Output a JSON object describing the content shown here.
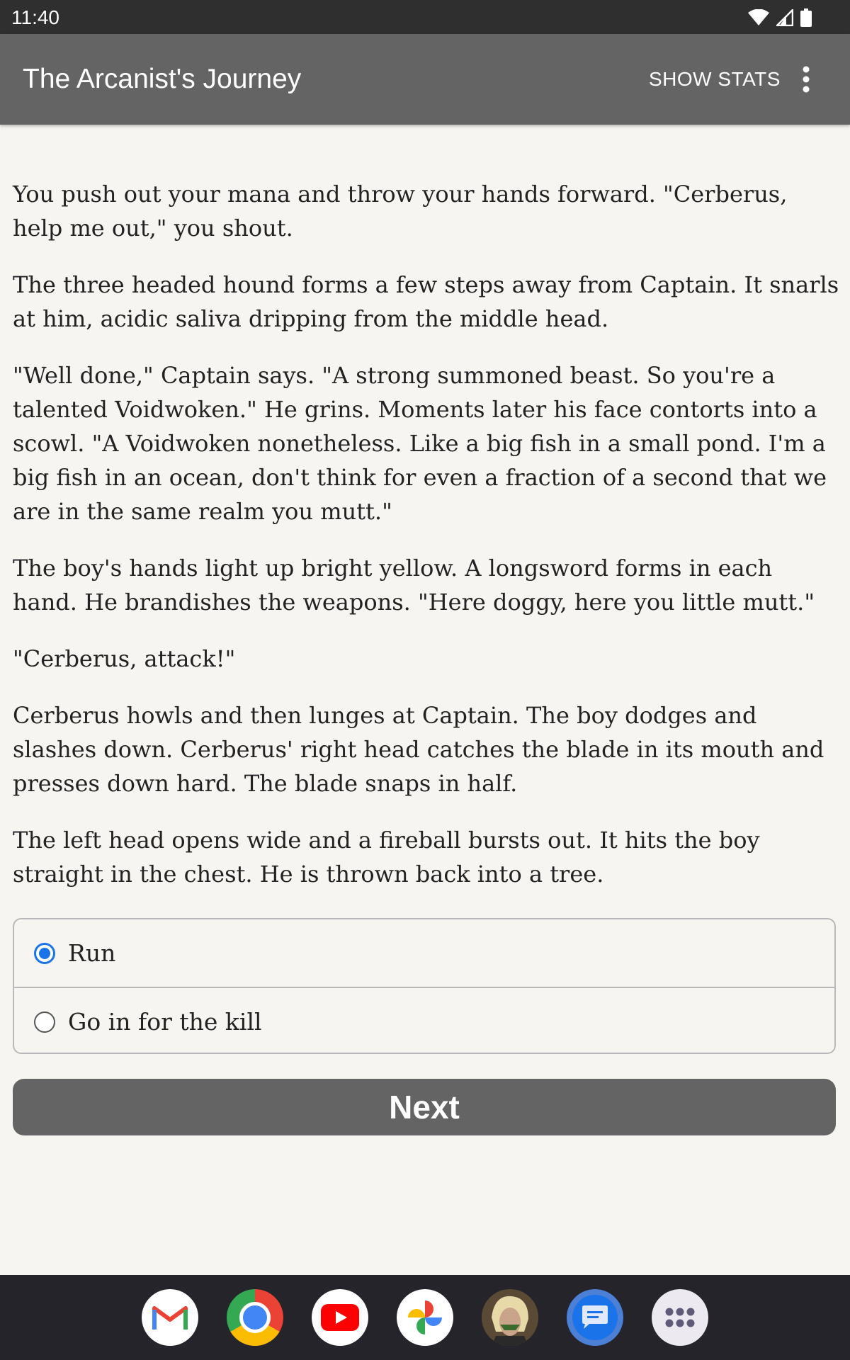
{
  "status_bar": {
    "time": "11:40",
    "icons": [
      "wifi-icon",
      "signal-icon",
      "battery-icon"
    ]
  },
  "app_bar": {
    "title": "The Arcanist's Journey",
    "show_stats_label": "SHOW STATS",
    "menu_icon": "more-vert-icon"
  },
  "story": {
    "paragraphs": [
      "You push out your mana and throw your hands forward. \"Cerberus, help me out,\" you shout.",
      "The three headed hound forms a few steps away from Captain. It snarls at him, acidic saliva dripping from the middle head.",
      "\"Well done,\" Captain says. \"A strong summoned beast. So you're a talented Voidwoken.\" He grins. Moments later his face contorts into a scowl. \"A Voidwoken nonetheless. Like a big fish in a small pond. I'm a big fish in an ocean, don't think for even a fraction of a second that we are in the same realm you mutt.\"",
      "The boy's hands light up bright yellow. A longsword forms in each hand. He brandishes the weapons. \"Here doggy, here you little mutt.\"",
      "\"Cerberus, attack!\"",
      "Cerberus howls and then lunges at Captain. The boy dodges and slashes down. Cerberus' right head catches the blade in its mouth and presses down hard. The blade snaps in half.",
      "The left head opens wide and a fireball bursts out. It hits the boy straight in the chest. He is thrown back into a tree."
    ]
  },
  "choices": [
    {
      "label": "Run",
      "selected": true
    },
    {
      "label": "Go in for the kill",
      "selected": false
    }
  ],
  "next_button": {
    "label": "Next"
  },
  "dock": {
    "apps": [
      "gmail-icon",
      "chrome-icon",
      "youtube-icon",
      "photos-icon",
      "game-avatar-icon",
      "messages-icon",
      "app-drawer-icon"
    ]
  },
  "colors": {
    "app_bar": "#646464",
    "background": "#f7f5f2",
    "radio_accent": "#1a73e8",
    "status_bar": "#2f2f2f",
    "dock": "#24242a"
  }
}
